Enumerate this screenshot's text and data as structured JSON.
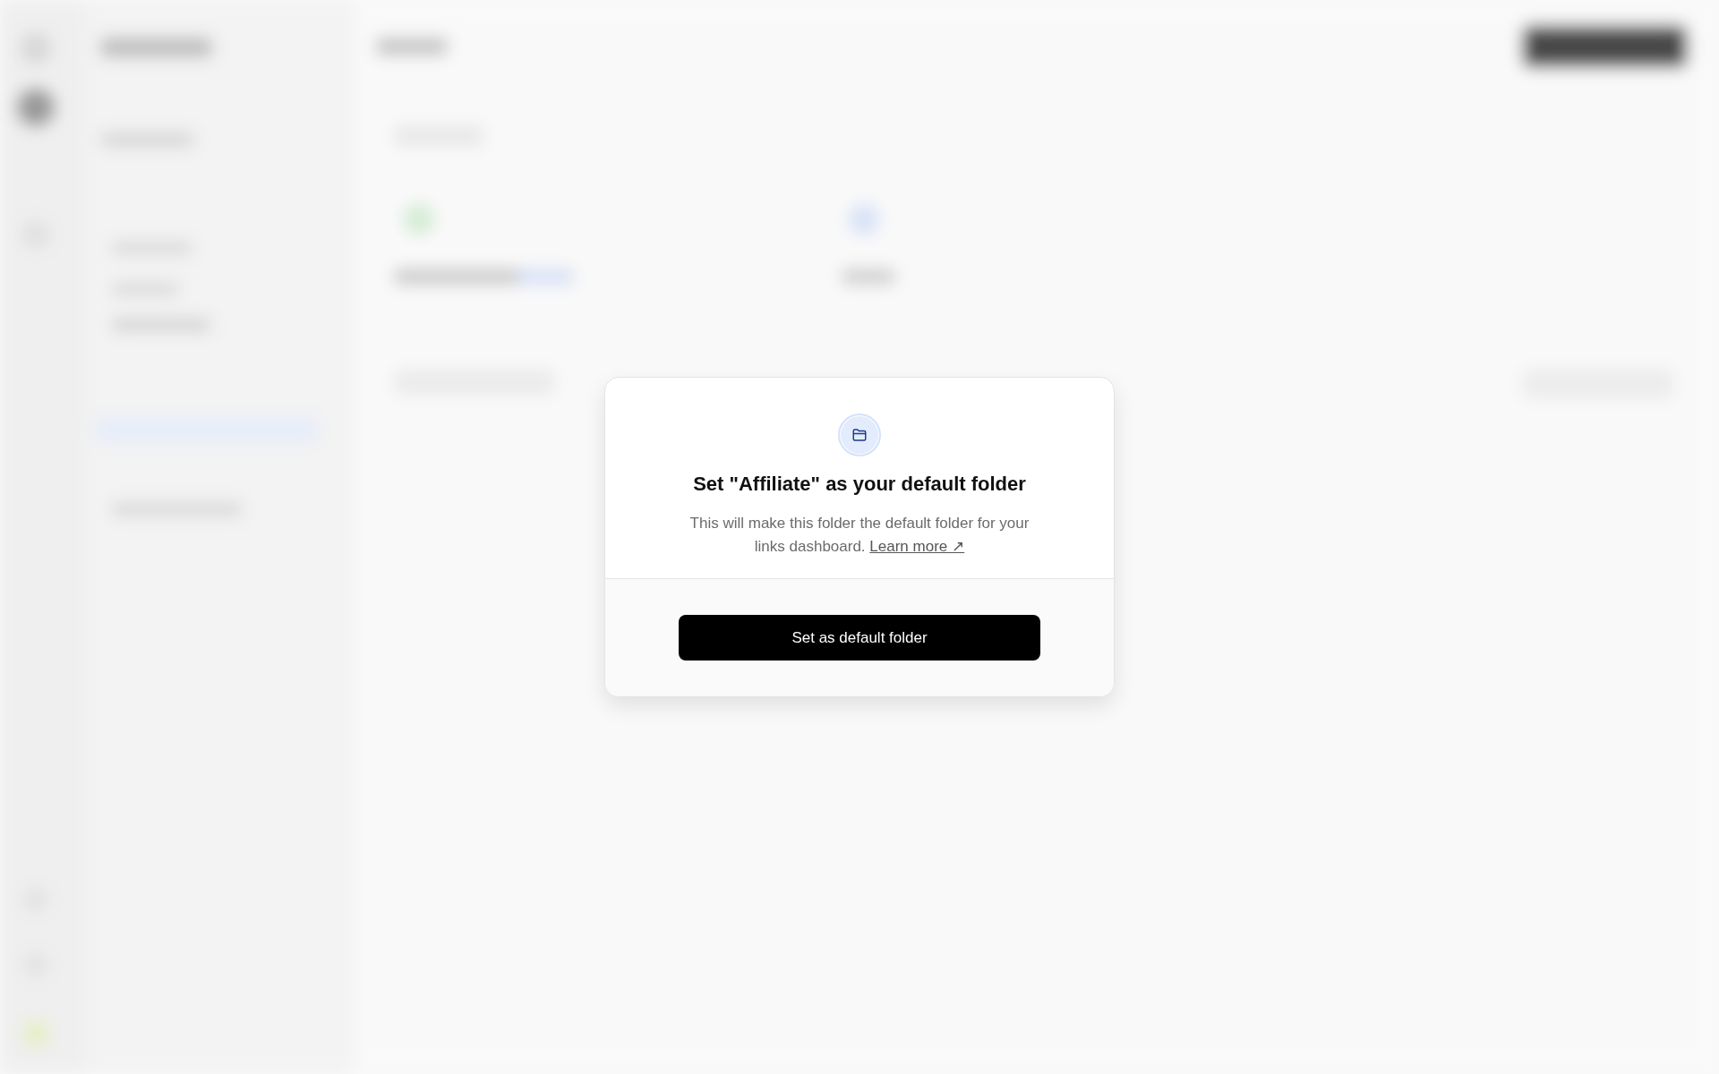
{
  "dialog": {
    "title": "Set \"Affiliate\" as your default folder",
    "description": "This will make this folder the default folder for your links dashboard.",
    "link": "Learn more ↗",
    "button": "Set as default folder"
  }
}
